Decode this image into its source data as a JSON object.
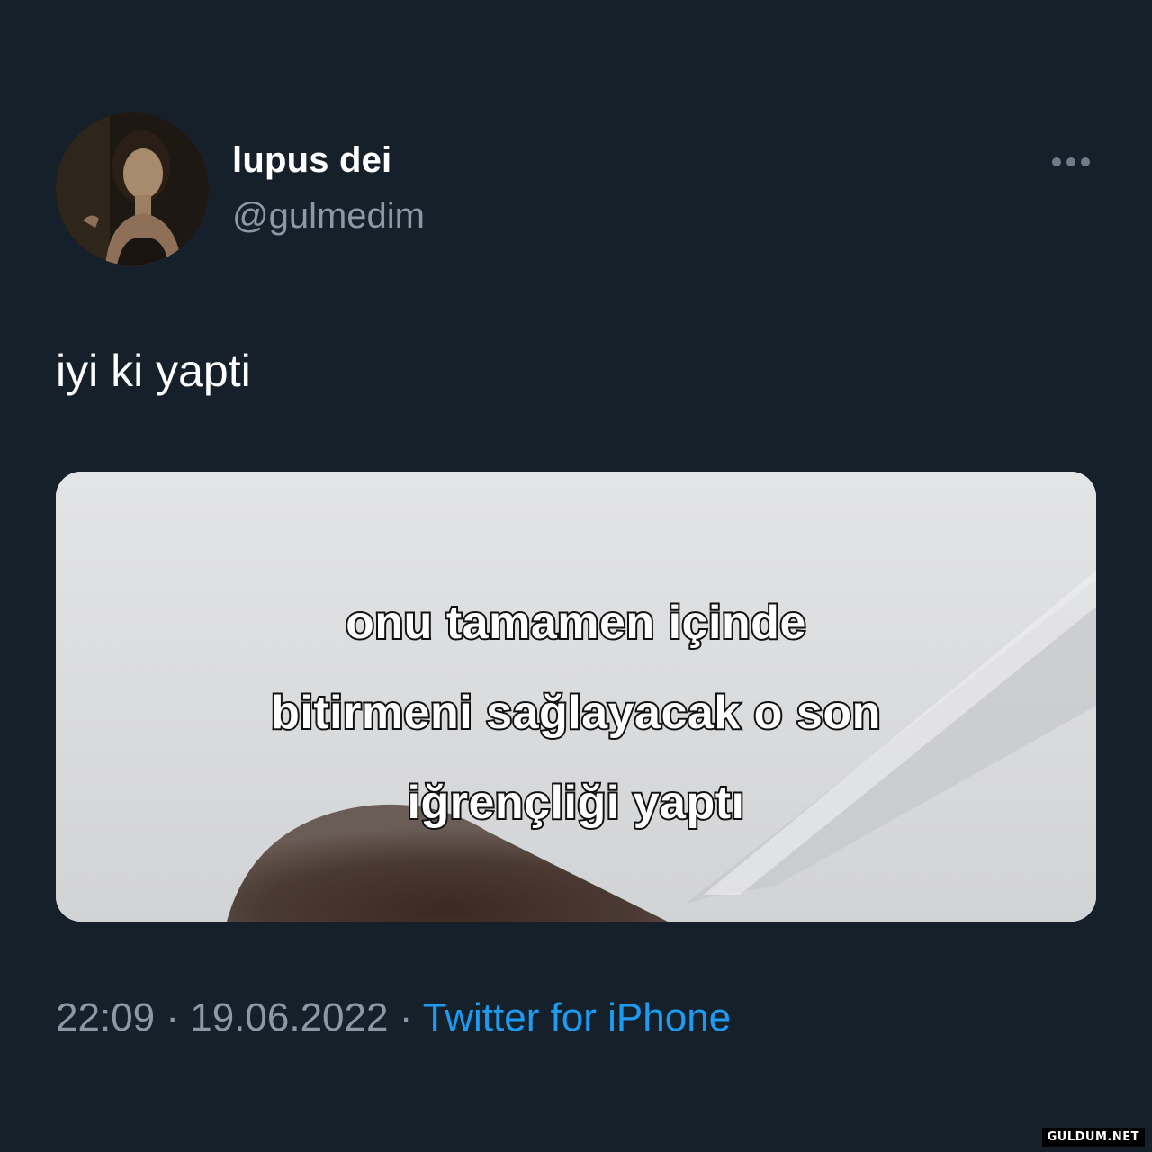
{
  "user": {
    "display_name": "lupus dei",
    "handle": "@gulmedim"
  },
  "menu": {
    "icon": "more-horizontal-icon"
  },
  "tweet": {
    "text": "iyi ki yapti",
    "media_caption": [
      "onu tamamen içinde",
      "bitirmeni sağlayacak o son",
      "iğrençliği yaptı"
    ]
  },
  "meta": {
    "time": "22:09",
    "separator": "·",
    "date": "19.06.2022",
    "source": "Twitter for iPhone"
  },
  "watermark": "GULDUM.NET",
  "colors": {
    "background": "#15202b",
    "primary_text": "#ffffff",
    "secondary_text": "#8b98a5",
    "link": "#1d9bf0"
  }
}
